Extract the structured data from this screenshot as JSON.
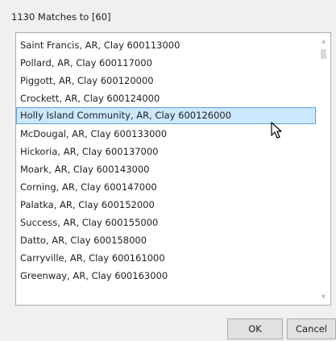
{
  "header": {
    "matches_label": "1130 Matches to [60]"
  },
  "list": {
    "items": [
      {
        "label": "Saint Francis, AR, Clay 600113000"
      },
      {
        "label": "Pollard, AR, Clay 600117000"
      },
      {
        "label": "Piggott, AR, Clay 600120000"
      },
      {
        "label": "Crockett, AR, Clay 600124000"
      },
      {
        "label": "Holly Island Community, AR, Clay 600126000"
      },
      {
        "label": "McDougal, AR, Clay 600133000"
      },
      {
        "label": "Hickoria, AR, Clay 600137000"
      },
      {
        "label": "Moark, AR, Clay 600143000"
      },
      {
        "label": "Corning, AR, Clay 600147000"
      },
      {
        "label": "Palatka, AR, Clay 600152000"
      },
      {
        "label": "Success, AR, Clay 600155000"
      },
      {
        "label": "Datto, AR, Clay 600158000"
      },
      {
        "label": "Carryville, AR, Clay 600161000"
      },
      {
        "label": "Greenway, AR, Clay 600163000"
      }
    ],
    "selected_index": 4
  },
  "scrollbar": {
    "up_icon": "chevron-up-icon",
    "down_icon": "chevron-down-icon"
  },
  "buttons": {
    "ok_label": "OK",
    "cancel_label": "Cancel"
  },
  "colors": {
    "selection_background": "#cce8ff",
    "selection_border": "#5da3e0",
    "dialog_background": "#f0f0f0"
  }
}
